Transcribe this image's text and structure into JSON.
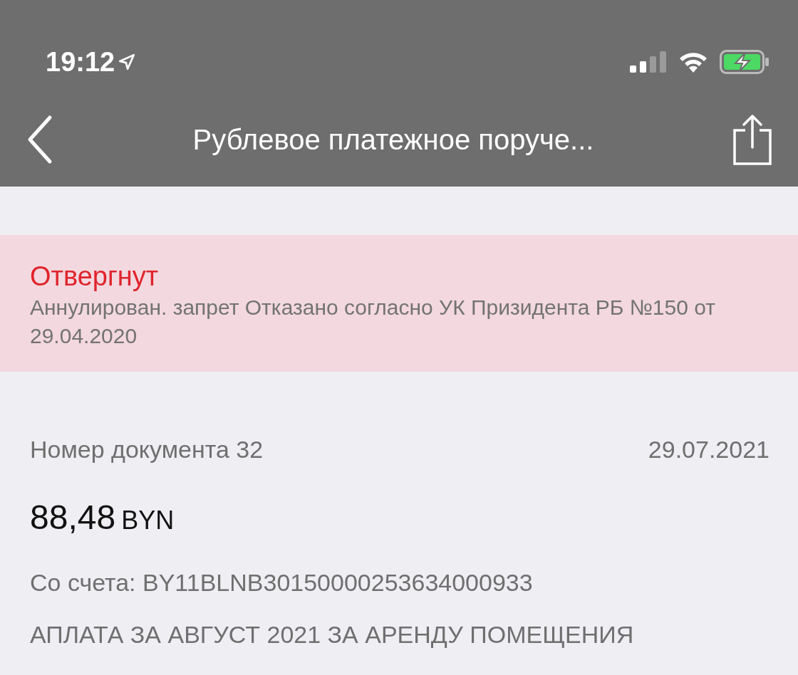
{
  "status_bar": {
    "time": "19:12"
  },
  "nav": {
    "title": "Рублевое платежное поруче..."
  },
  "banner": {
    "status": "Отвергнут",
    "reason": "Аннулирован. запрет Отказано согласно УК Призидента РБ №150 от 29.04.2020"
  },
  "document": {
    "number": "Номер документа 32",
    "date": "29.07.2021",
    "amount": "88,48",
    "currency": "BYN",
    "account": "Со счета: BY11BLNB30150000253634000933",
    "purpose": "АПЛАТА ЗА АВГУСТ 2021 ЗА АРЕНДУ ПОМЕЩЕНИЯ"
  }
}
